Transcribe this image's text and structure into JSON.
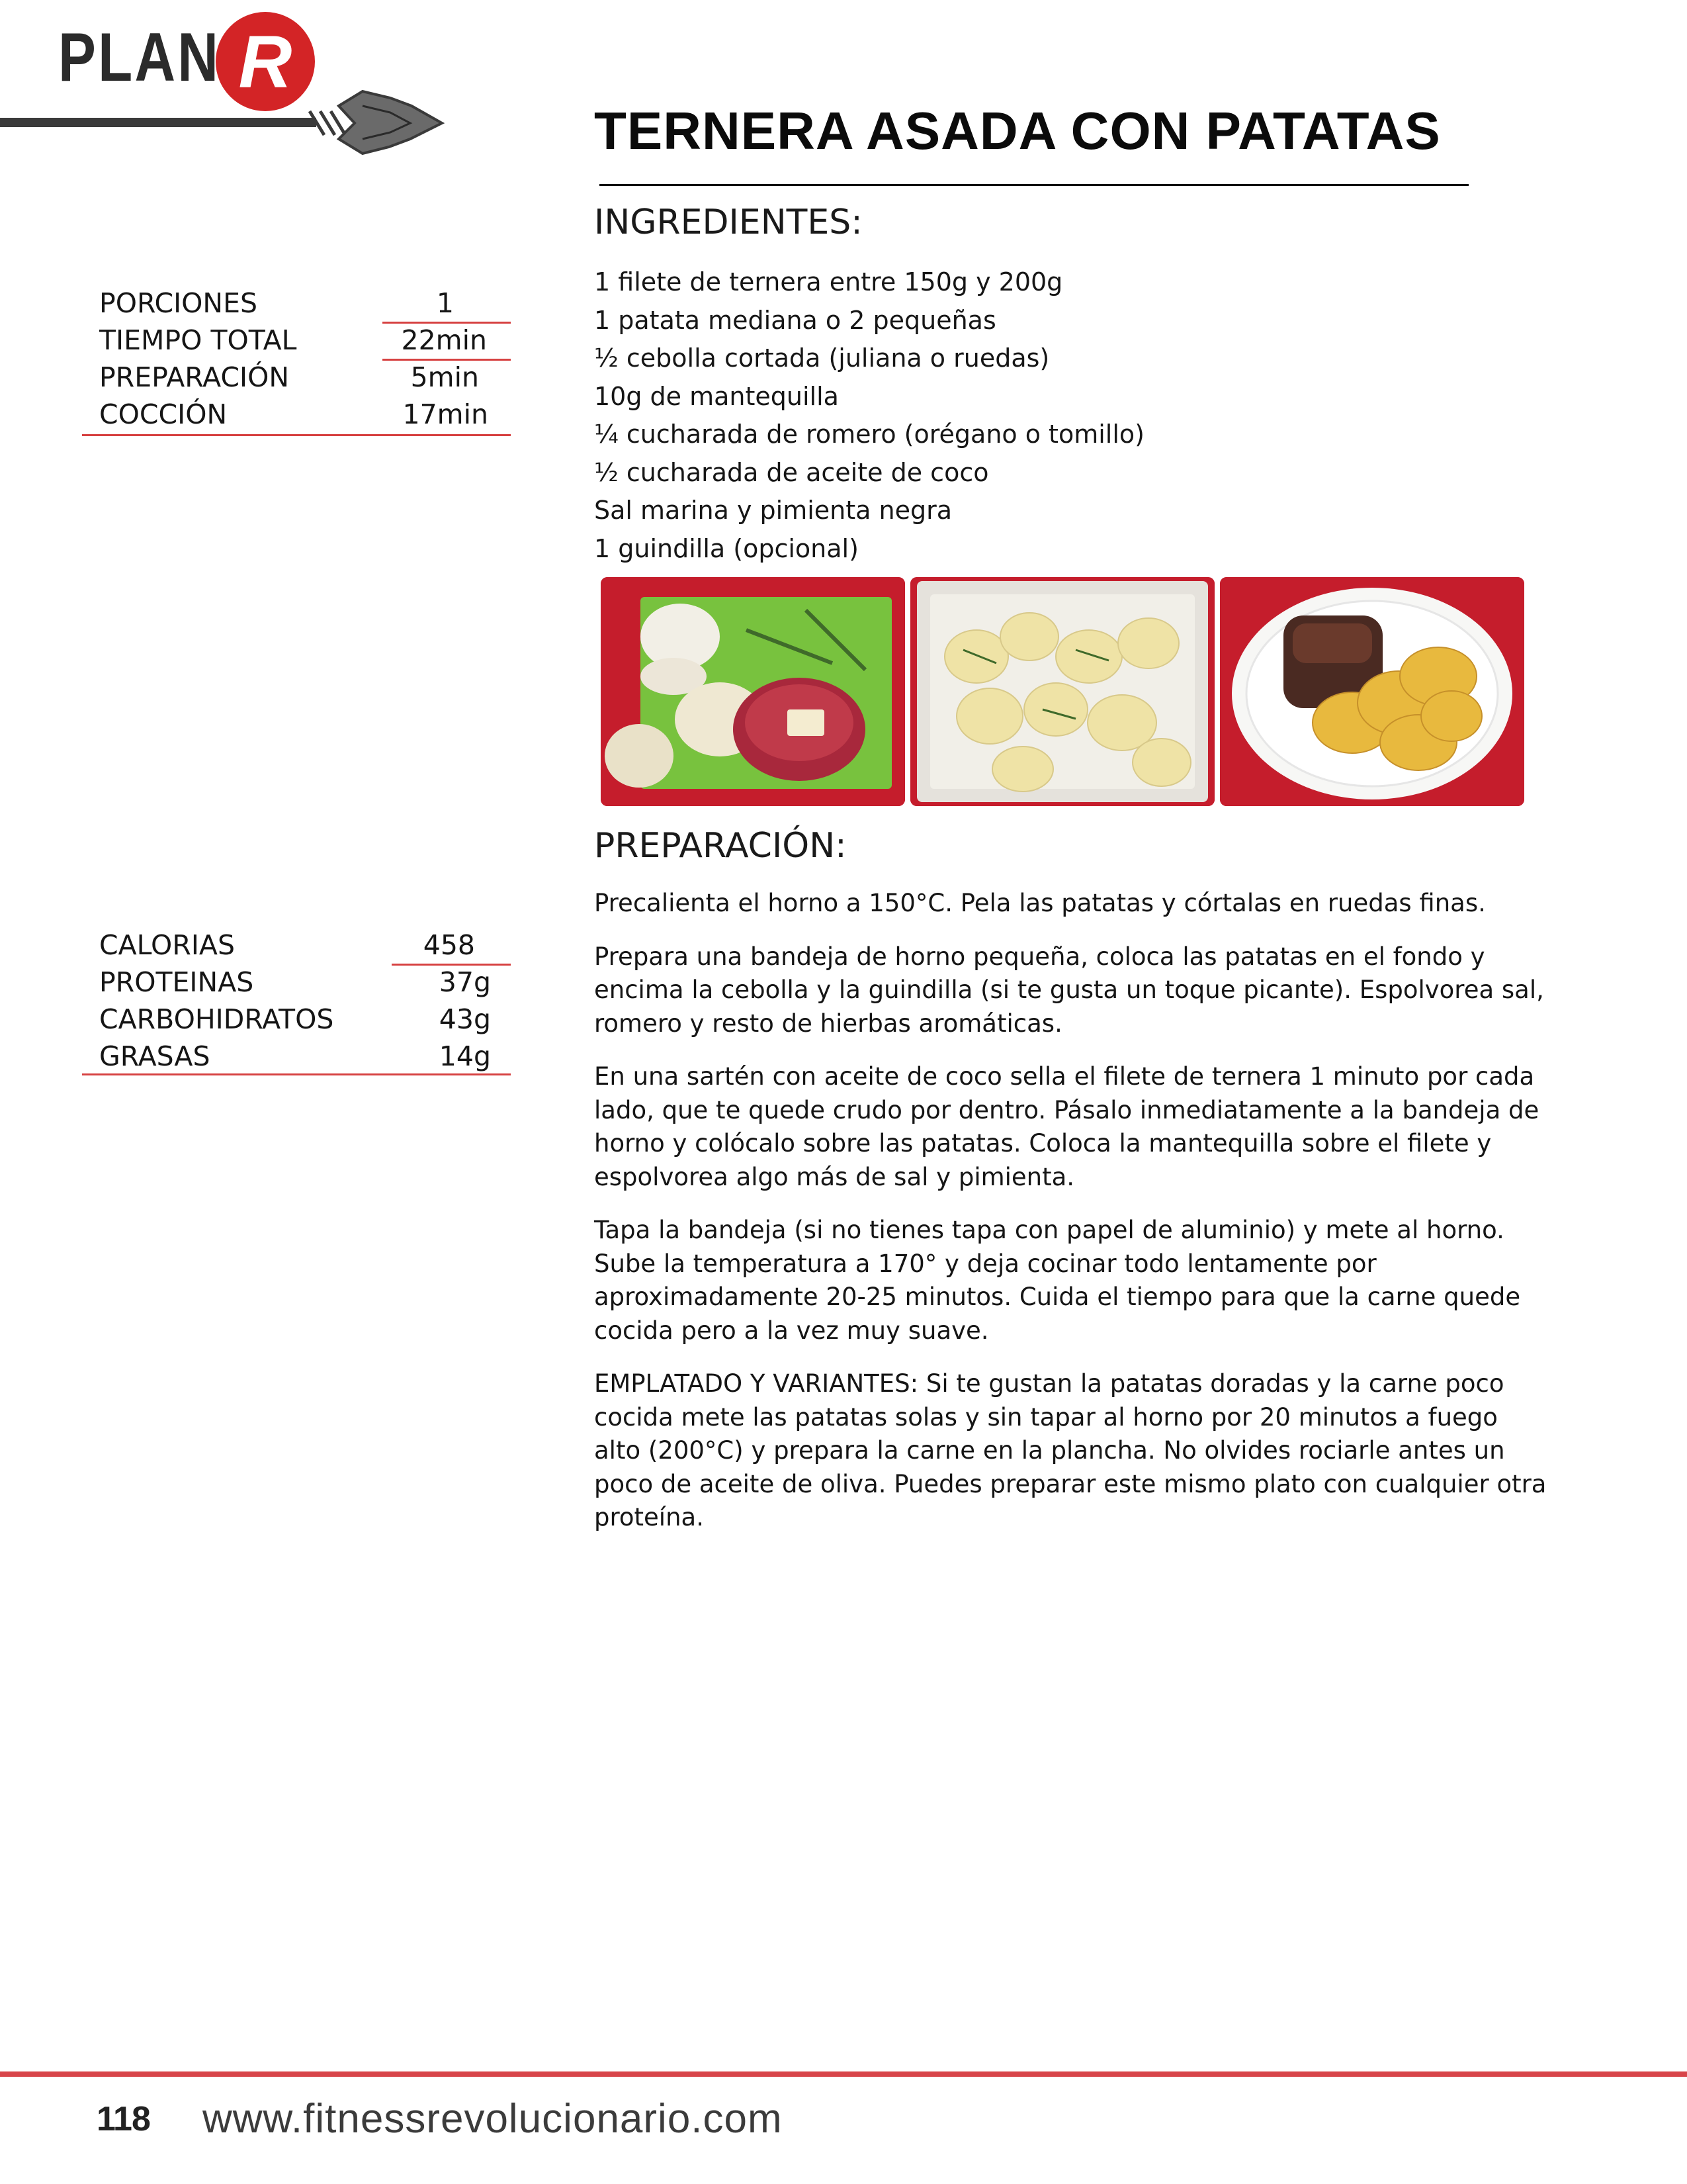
{
  "logo": {
    "word": "PLAN",
    "badge": "R"
  },
  "recipe": {
    "title": "TERNERA ASADA CON PATATAS"
  },
  "ingredients": {
    "heading": "INGREDIENTES:",
    "items": [
      "1 filete de ternera entre 150g y 200g",
      "1 patata mediana o 2 pequeñas",
      "½ cebolla cortada (juliana o ruedas)",
      "10g de mantequilla",
      "¼ cucharada de romero (orégano o tomillo)",
      "½ cucharada de aceite de coco",
      "Sal marina y pimienta negra",
      "1 guindilla (opcional)"
    ]
  },
  "timing": [
    {
      "label": "PORCIONES",
      "value": "1"
    },
    {
      "label": "TIEMPO TOTAL",
      "value": "22min"
    },
    {
      "label": "PREPARACIÓN",
      "value": "5min"
    },
    {
      "label": "COCCIÓN",
      "value": "17min"
    }
  ],
  "nutrition": [
    {
      "label": "CALORIAS",
      "value": "458"
    },
    {
      "label": "PROTEINAS",
      "value": "37g"
    },
    {
      "label": "CARBOHIDRATOS",
      "value": "43g"
    },
    {
      "label": "GRASAS",
      "value": "14g"
    }
  ],
  "preparation": {
    "heading": "PREPARACIÓN:",
    "paragraphs": [
      "Precalienta el horno a 150°C. Pela las patatas y córtalas en ruedas finas.",
      "Prepara una bandeja de horno pequeña, coloca las patatas en el fondo y encima la cebolla y la guindilla (si te gusta un toque picante).  Espolvorea sal, romero y resto de hierbas aromáticas.",
      "En una sartén con aceite de coco sella el filete de ternera 1 minuto por cada lado, que te quede crudo por dentro. Pásalo inmediatamente a la bandeja de horno y colócalo sobre las patatas. Coloca la mantequilla sobre el filete y espolvorea algo más de sal y pimienta.",
      "Tapa la bandeja (si no tienes tapa con papel de aluminio) y mete al horno. Sube la temperatura a 170° y deja cocinar todo lentamente por aproximadamente 20-25 minutos. Cuida el tiempo para que la carne quede cocida pero a la vez muy suave.",
      "EMPLATADO Y VARIANTES: Si te gustan la patatas doradas y la carne poco cocida mete las patatas solas y sin tapar al horno por 20 minutos  a fuego alto (200°C) y prepara la carne en la plancha. No olvides rociarle antes un poco de aceite de oliva. Puedes  preparar este mismo plato con cualquier otra proteína."
    ]
  },
  "footer": {
    "page_number": "118",
    "website": "www.fitnessrevolucionario.com"
  },
  "colors": {
    "brand_red": "#d32426",
    "rule_red": "#d64040",
    "photo_background": "#c71f2d"
  }
}
